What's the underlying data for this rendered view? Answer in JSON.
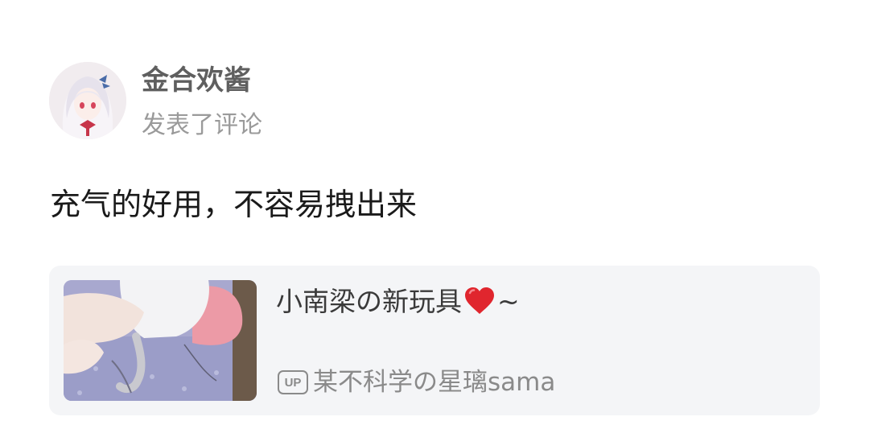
{
  "post": {
    "user_name": "金合欢酱",
    "action": "发表了评论",
    "comment": "充气的好用，不容易拽出来"
  },
  "video_card": {
    "title": "小南梁の新玩具",
    "title_emoji": "heart-icon",
    "title_suffix": "~",
    "up_badge": "UP",
    "uploader": "某不科学の星璃sama"
  },
  "colors": {
    "background": "#ffffff",
    "card_background": "#f4f5f7",
    "user_name": "#5f5f5f",
    "secondary_text": "#9a9a9a",
    "heart": "#e0262e"
  }
}
